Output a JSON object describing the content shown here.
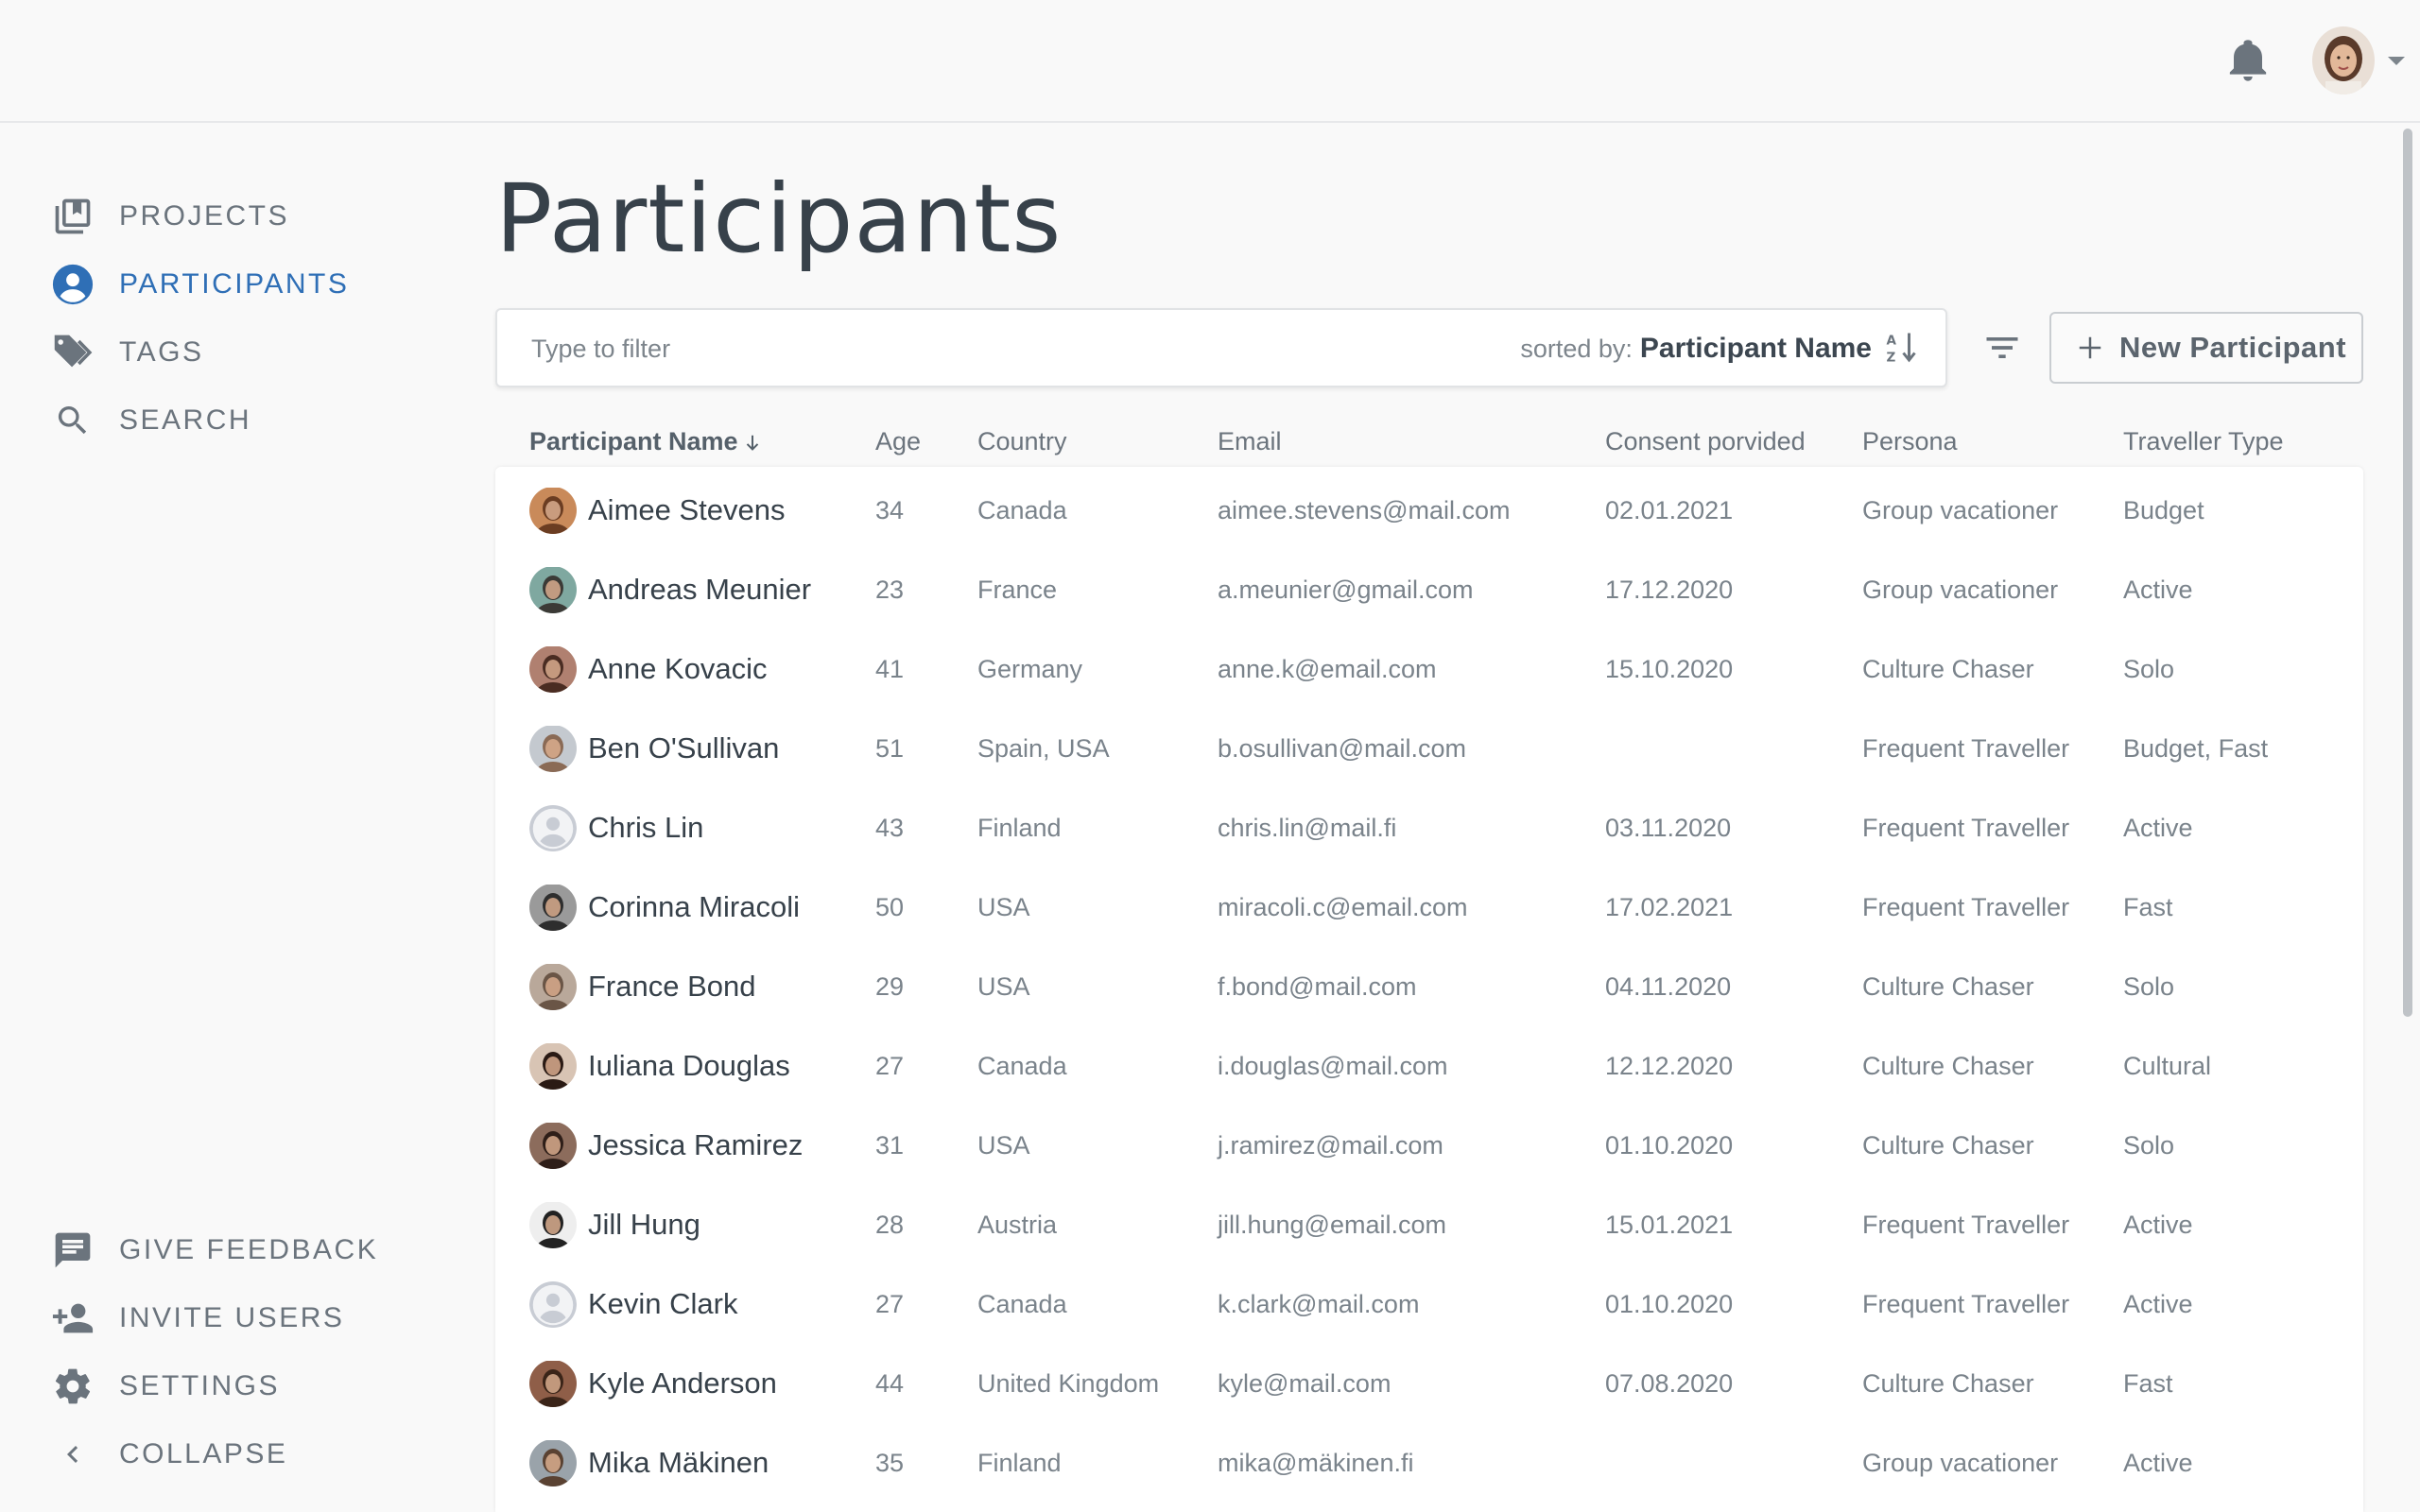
{
  "header": {
    "notifications_icon": "bell-icon",
    "user_avatar": "user-avatar",
    "menu_icon": "caret-down-icon"
  },
  "sidebar": {
    "top_items": [
      {
        "label": "PROJECTS",
        "icon": "projects-icon",
        "active": false
      },
      {
        "label": "PARTICIPANTS",
        "icon": "participants-icon",
        "active": true
      },
      {
        "label": "TAGS",
        "icon": "tags-icon",
        "active": false
      },
      {
        "label": "SEARCH",
        "icon": "search-icon",
        "active": false
      }
    ],
    "bottom_items": [
      {
        "label": "GIVE FEEDBACK",
        "icon": "feedback-icon"
      },
      {
        "label": "INVITE USERS",
        "icon": "invite-user-icon"
      },
      {
        "label": "SETTINGS",
        "icon": "gear-icon"
      },
      {
        "label": "COLLAPSE",
        "icon": "chevron-left-icon"
      }
    ]
  },
  "main": {
    "title": "Participants",
    "filter": {
      "placeholder": "Type to filter",
      "value": "",
      "sorted_by_prefix": "sorted by:",
      "sorted_by_value": "Participant Name"
    },
    "new_button_label": "New Participant",
    "columns": [
      "Participant Name",
      "Age",
      "Country",
      "Email",
      "Consent porvided",
      "Persona",
      "Traveller Type"
    ],
    "rows": [
      {
        "name": "Aimee Stevens",
        "age": "34",
        "country": "Canada",
        "email": "aimee.stevens@mail.com",
        "consent": "02.01.2021",
        "persona": "Group vacationer",
        "type": "Budget",
        "avatar": "photo"
      },
      {
        "name": "Andreas Meunier",
        "age": "23",
        "country": "France",
        "email": "a.meunier@gmail.com",
        "consent": "17.12.2020",
        "persona": "Group vacationer",
        "type": "Active",
        "avatar": "photo"
      },
      {
        "name": "Anne Kovacic",
        "age": "41",
        "country": "Germany",
        "email": "anne.k@email.com",
        "consent": "15.10.2020",
        "persona": "Culture Chaser",
        "type": "Solo",
        "avatar": "photo"
      },
      {
        "name": "Ben O'Sullivan",
        "age": "51",
        "country": "Spain, USA",
        "email": "b.osullivan@mail.com",
        "consent": "",
        "persona": "Frequent Traveller",
        "type": "Budget, Fast",
        "avatar": "photo"
      },
      {
        "name": "Chris Lin",
        "age": "43",
        "country": "Finland",
        "email": "chris.lin@mail.fi",
        "consent": "03.11.2020",
        "persona": "Frequent Traveller",
        "type": "Active",
        "avatar": "placeholder"
      },
      {
        "name": "Corinna Miracoli",
        "age": "50",
        "country": "USA",
        "email": "miracoli.c@email.com",
        "consent": "17.02.2021",
        "persona": "Frequent Traveller",
        "type": "Fast",
        "avatar": "photo"
      },
      {
        "name": "France Bond",
        "age": "29",
        "country": "USA",
        "email": "f.bond@mail.com",
        "consent": "04.11.2020",
        "persona": "Culture Chaser",
        "type": "Solo",
        "avatar": "photo"
      },
      {
        "name": "Iuliana Douglas",
        "age": "27",
        "country": "Canada",
        "email": "i.douglas@mail.com",
        "consent": "12.12.2020",
        "persona": "Culture Chaser",
        "type": "Cultural",
        "avatar": "photo"
      },
      {
        "name": "Jessica Ramirez",
        "age": "31",
        "country": "USA",
        "email": "j.ramirez@mail.com",
        "consent": "01.10.2020",
        "persona": "Culture Chaser",
        "type": "Solo",
        "avatar": "photo"
      },
      {
        "name": "Jill Hung",
        "age": "28",
        "country": "Austria",
        "email": "jill.hung@email.com",
        "consent": "15.01.2021",
        "persona": "Frequent Traveller",
        "type": "Active",
        "avatar": "photo"
      },
      {
        "name": "Kevin Clark",
        "age": "27",
        "country": "Canada",
        "email": "k.clark@mail.com",
        "consent": "01.10.2020",
        "persona": "Frequent Traveller",
        "type": "Active",
        "avatar": "placeholder"
      },
      {
        "name": "Kyle Anderson",
        "age": "44",
        "country": "United Kingdom",
        "email": "kyle@mail.com",
        "consent": "07.08.2020",
        "persona": "Culture Chaser",
        "type": "Fast",
        "avatar": "photo"
      },
      {
        "name": "Mika Mäkinen",
        "age": "35",
        "country": "Finland",
        "email": "mika@mäkinen.fi",
        "consent": "",
        "persona": "Group vacationer",
        "type": "Active",
        "avatar": "photo"
      }
    ]
  },
  "colors": {
    "accent": "#2f6fb6",
    "text_primary": "#37414a",
    "text_secondary": "#7a838b",
    "background": "#f9f9f9"
  }
}
